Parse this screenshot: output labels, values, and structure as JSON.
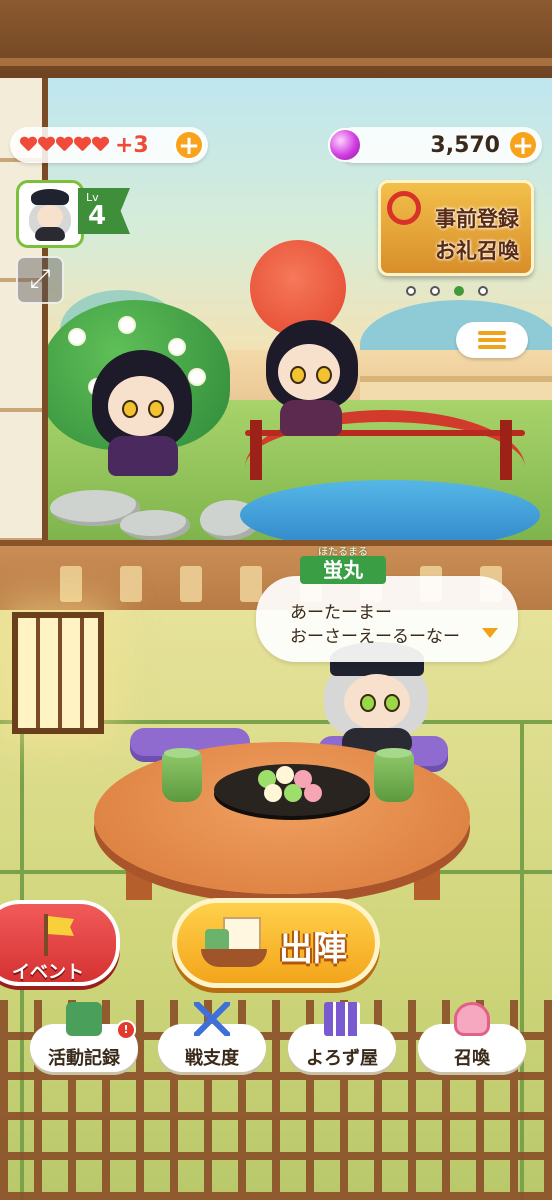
{
  "hud": {
    "stamina_extra": "+3",
    "currency_value": "3,570",
    "level_label": "Lv",
    "level_value": "4"
  },
  "banner": {
    "line1": "事前登録",
    "line2": "お礼召喚",
    "page_count": 4,
    "active_page": 3
  },
  "dialogue": {
    "speaker_ruby": "ほたるまる",
    "speaker_name": "蛍丸",
    "line1": "あーたーまー",
    "line2": "おーさーえーるーなー"
  },
  "actions": {
    "event_label": "イベント",
    "sortie_label": "出陣"
  },
  "nav": {
    "activity_log": "活動記録",
    "activity_badge": "!",
    "battle_prep": "戦支度",
    "shop": "よろず屋",
    "summon": "召喚"
  },
  "colors": {
    "accent_orange": "#f9a21b",
    "heart_red": "#ef4a3a",
    "level_green": "#3f8f3a",
    "event_red": "#d63232"
  }
}
